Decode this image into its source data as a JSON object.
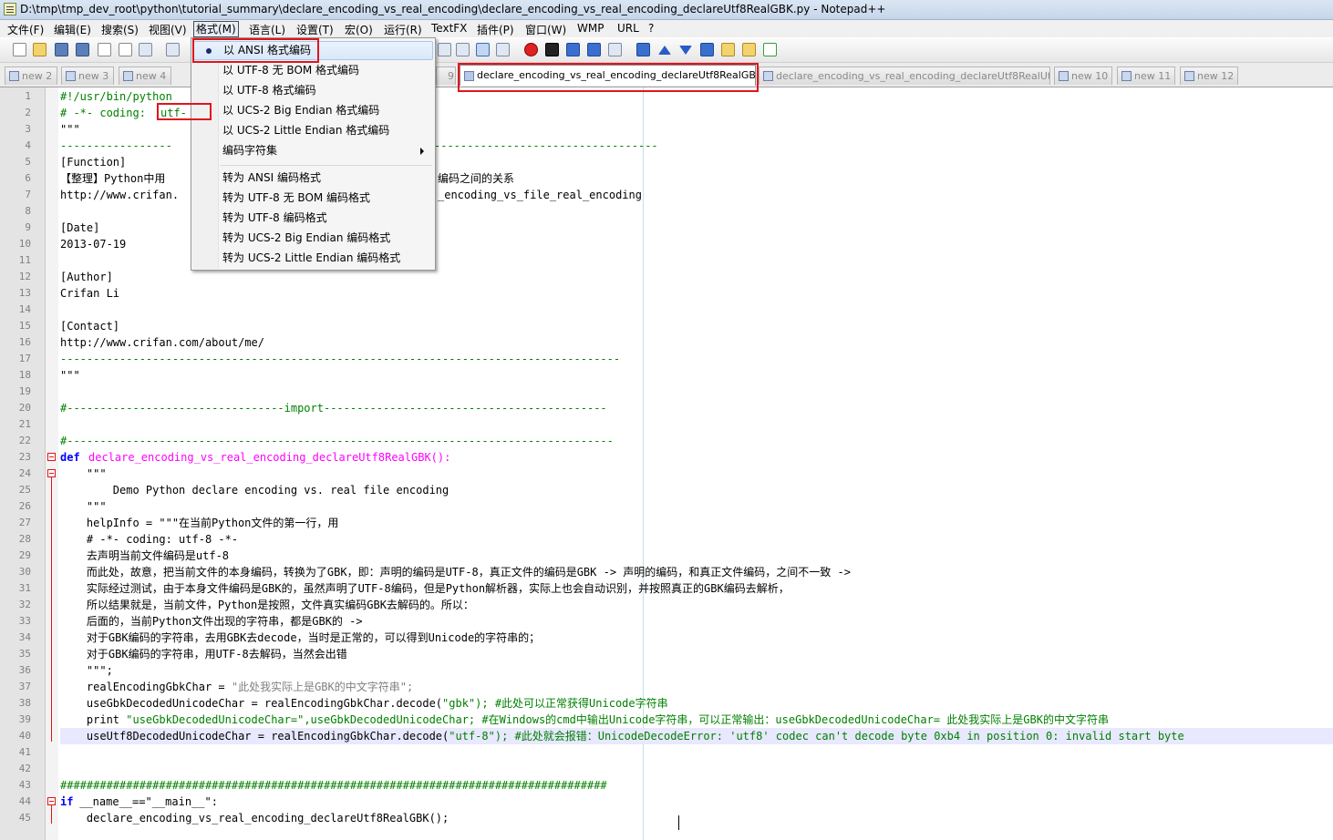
{
  "window": {
    "title": "D:\\tmp\\tmp_dev_root\\python\\tutorial_summary\\declare_encoding_vs_real_encoding\\declare_encoding_vs_real_encoding_declareUtf8RealGBK.py - Notepad++"
  },
  "menubar": {
    "items": [
      "文件(F)",
      "编辑(E)",
      "搜索(S)",
      "视图(V)",
      "格式(M)",
      "语言(L)",
      "设置(T)",
      "宏(O)",
      "运行(R)",
      "TextFX",
      "插件(P)",
      "窗口(W)",
      "WMP",
      "URL",
      "?"
    ]
  },
  "tabs": [
    {
      "label": "new 2"
    },
    {
      "label": "new 3"
    },
    {
      "label": "new 4"
    },
    {
      "label": "9"
    },
    {
      "label": "declare_encoding_vs_real_encoding_declareUtf8RealGBK.py"
    },
    {
      "label": "declare_encoding_vs_real_encoding_declareUtf8RealUtf8.py"
    },
    {
      "label": "new 10"
    },
    {
      "label": "new 11"
    },
    {
      "label": "new 12"
    }
  ],
  "format_menu": {
    "items": [
      {
        "label": "以 ANSI 格式编码",
        "checked": true
      },
      {
        "label": "以 UTF-8 无 BOM 格式编码"
      },
      {
        "label": "以 UTF-8 格式编码"
      },
      {
        "label": "以 UCS-2 Big Endian 格式编码"
      },
      {
        "label": "以 UCS-2 Little Endian 格式编码"
      },
      {
        "label": "编码字符集",
        "submenu": true
      },
      {
        "label": "转为 ANSI 编码格式"
      },
      {
        "label": "转为 UTF-8 无 BOM 编码格式"
      },
      {
        "label": "转为 UTF-8 编码格式"
      },
      {
        "label": "转为 UCS-2 Big Endian 编码格式"
      },
      {
        "label": "转为 UCS-2 Little Endian 编码格式"
      }
    ]
  },
  "editor": {
    "lines": [
      {
        "n": "1",
        "pre": "#!/usr/bin/python",
        "post": ""
      },
      {
        "n": "2",
        "pre": "# -*- coding: ",
        "post": "utf-"
      },
      {
        "n": "3",
        "pre": "\"\"\"",
        "post": ""
      },
      {
        "n": "4",
        "pre": "-----------------",
        "post": "----------------------------------"
      },
      {
        "n": "5",
        "pre": "[Function]",
        "post": ""
      },
      {
        "n": "6",
        "pre": "【整理】Python中用",
        "post": "编码之间的关系"
      },
      {
        "n": "7",
        "pre": "http://www.crifan.",
        "post": "_encoding_vs_file_real_encoding"
      },
      {
        "n": "8",
        "pre": "",
        "post": ""
      },
      {
        "n": "9",
        "pre": "[Date]",
        "post": ""
      },
      {
        "n": "10",
        "pre": "2013-07-19",
        "post": ""
      },
      {
        "n": "11",
        "pre": "",
        "post": ""
      },
      {
        "n": "12",
        "pre": "[Author]",
        "post": ""
      },
      {
        "n": "13",
        "pre": "Crifan Li",
        "post": ""
      },
      {
        "n": "14",
        "pre": "",
        "post": ""
      },
      {
        "n": "15",
        "pre": "[Contact]",
        "post": ""
      },
      {
        "n": "16",
        "pre": "http://www.crifan.com/about/me/",
        "post": ""
      },
      {
        "n": "17",
        "pre": "-------------------------------------------------------------------------------------",
        "post": ""
      },
      {
        "n": "18",
        "pre": "\"\"\"",
        "post": ""
      },
      {
        "n": "19",
        "pre": "",
        "post": ""
      },
      {
        "n": "20",
        "pre": "#---------------------------------import-------------------------------------------",
        "post": ""
      },
      {
        "n": "21",
        "pre": "",
        "post": ""
      },
      {
        "n": "22",
        "pre": "#-----------------------------------------------------------------------------------",
        "post": ""
      },
      {
        "n": "23",
        "pre": "def",
        "post": "declare_encoding_vs_real_encoding_declareUtf8RealGBK():"
      },
      {
        "n": "24",
        "pre": "    \"\"\"",
        "post": ""
      },
      {
        "n": "25",
        "pre": "        Demo Python declare encoding vs. real file encoding",
        "post": ""
      },
      {
        "n": "26",
        "pre": "    \"\"\"",
        "post": ""
      },
      {
        "n": "27",
        "pre": "    helpInfo = \"\"\"在当前Python文件的第一行，用",
        "post": ""
      },
      {
        "n": "28",
        "pre": "    # -*- coding: utf-8 -*-",
        "post": ""
      },
      {
        "n": "29",
        "pre": "    去声明当前文件编码是utf-8",
        "post": ""
      },
      {
        "n": "30",
        "pre": "    而此处，故意，把当前文件的本身编码，转换为了GBK，即：声明的编码是UTF-8，真正文件的编码是GBK -> 声明的编码，和真正文件编码，之间不一致 ->",
        "post": ""
      },
      {
        "n": "31",
        "pre": "    实际经过测试，由于本身文件编码是GBK的，虽然声明了UTF-8编码，但是Python解析器，实际上也会自动识别，并按照真正的GBK编码去解析，",
        "post": ""
      },
      {
        "n": "32",
        "pre": "    所以结果就是，当前文件，Python是按照，文件真实编码GBK去解码的。所以：",
        "post": ""
      },
      {
        "n": "33",
        "pre": "    后面的，当前Python文件出现的字符串，都是GBK的 ->",
        "post": ""
      },
      {
        "n": "34",
        "pre": "    对于GBK编码的字符串，去用GBK去decode，当时是正常的，可以得到Unicode的字符串的；",
        "post": ""
      },
      {
        "n": "35",
        "pre": "    对于GBK编码的字符串，用UTF-8去解码，当然会出错",
        "post": ""
      },
      {
        "n": "36",
        "pre": "    \"\"\";",
        "post": ""
      },
      {
        "n": "37",
        "pre": "    realEncodingGbkChar = ",
        "post": "\"此处我实际上是GBK的中文字符串\";"
      },
      {
        "n": "38",
        "pre": "    useGbkDecodedUnicodeChar = realEncodingGbkChar.decode(",
        "post": "\"gbk\"); #此处可以正常获得Unicode字符串"
      },
      {
        "n": "39",
        "pre": "    print ",
        "post": "\"useGbkDecodedUnicodeChar=\",useGbkDecodedUnicodeChar; #在Windows的cmd中输出Unicode字符串，可以正常输出：useGbkDecodedUnicodeChar= 此处我实际上是GBK的中文字符串"
      },
      {
        "n": "40",
        "pre": "    useUtf8DecodedUnicodeChar = realEncodingGbkChar.decode(",
        "post": "\"utf-8\"); #此处就会报错：UnicodeDecodeError: 'utf8' codec can't decode byte 0xb4 in position 0: invalid start byte"
      },
      {
        "n": "41",
        "pre": "    ",
        "post": ""
      },
      {
        "n": "42",
        "pre": "",
        "post": ""
      },
      {
        "n": "43",
        "pre": "###################################################################################",
        "post": ""
      },
      {
        "n": "44",
        "pre": "if",
        "post": " __name__==\"__main__\":"
      },
      {
        "n": "45",
        "pre": "    declare_encoding_vs_real_encoding_declareUtf8RealGBK();",
        "post": ""
      }
    ]
  }
}
